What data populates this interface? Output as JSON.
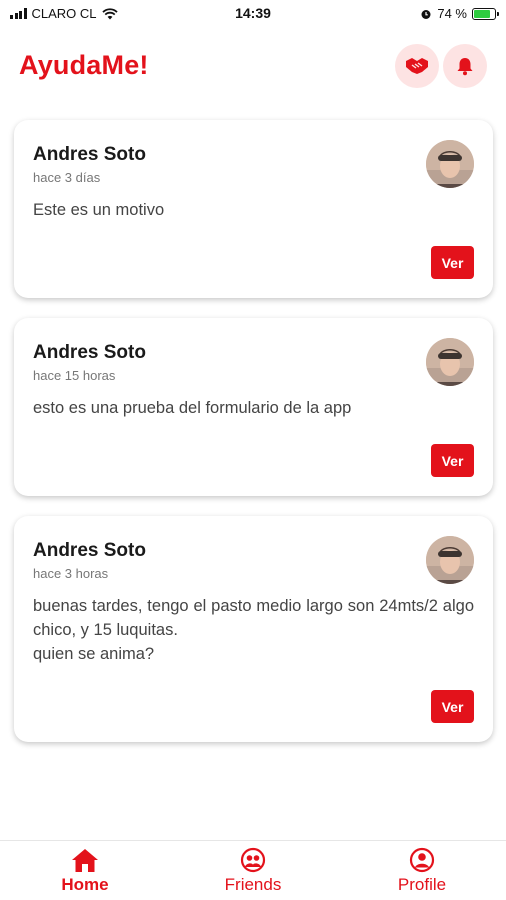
{
  "status_bar": {
    "carrier": "CLARO CL",
    "time": "14:39",
    "battery_text": "74 %",
    "battery_level": 0.74
  },
  "header": {
    "title": "AyudaMe!"
  },
  "posts": [
    {
      "name": "Andres Soto",
      "time": "hace 3 días",
      "message": "Este es un motivo",
      "button": "Ver"
    },
    {
      "name": "Andres Soto",
      "time": "hace 15 horas",
      "message": "esto es una prueba del formulario de la app",
      "button": "Ver"
    },
    {
      "name": "Andres Soto",
      "time": "hace 3 horas",
      "message": "buenas tardes, tengo el pasto medio largo son 24mts/2 algo chico, y 15 luquitas.\nquien se anima?",
      "button": "Ver"
    }
  ],
  "nav": [
    {
      "label": "Home",
      "icon": "home-icon",
      "active": true
    },
    {
      "label": "Friends",
      "icon": "friends-icon",
      "active": false
    },
    {
      "label": "Profile",
      "icon": "profile-icon",
      "active": false
    }
  ],
  "colors": {
    "accent": "#e3121b",
    "accent_soft": "#fde3e3"
  }
}
